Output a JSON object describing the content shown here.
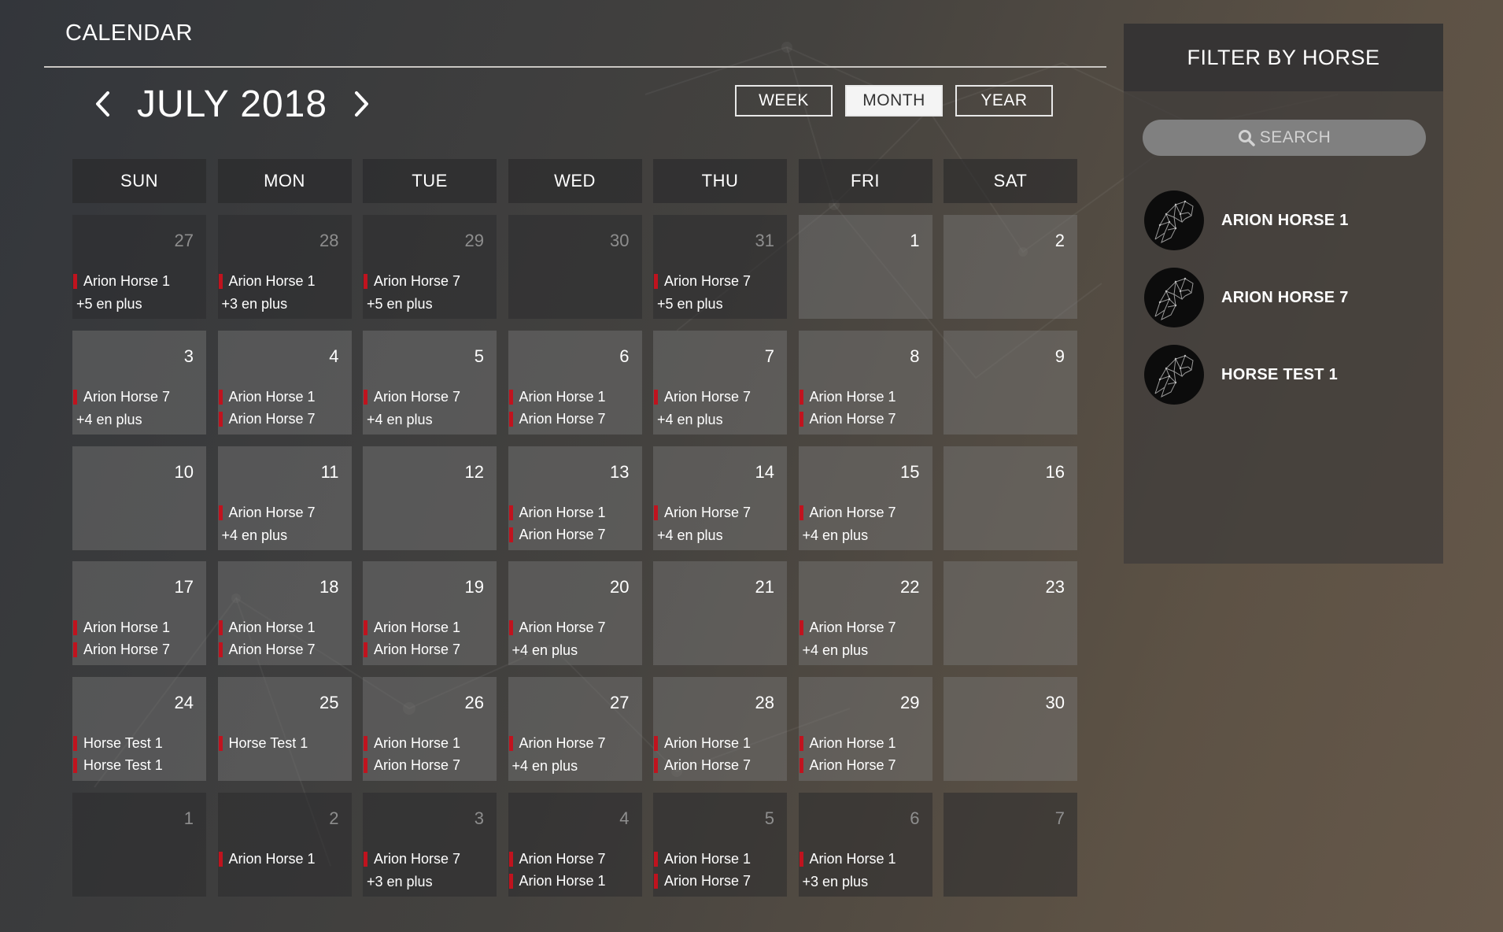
{
  "header": {
    "title": "CALENDAR",
    "month_label": "JULY 2018",
    "views": [
      {
        "label": "WEEK",
        "active": false
      },
      {
        "label": "MONTH",
        "active": true
      },
      {
        "label": "YEAR",
        "active": false
      }
    ]
  },
  "calendar": {
    "day_headers": [
      "SUN",
      "MON",
      "TUE",
      "WED",
      "THU",
      "FRI",
      "SAT"
    ],
    "weeks": [
      [
        {
          "num": "27",
          "other": true,
          "events": [
            "Arion Horse 1"
          ],
          "more": "+5 en plus"
        },
        {
          "num": "28",
          "other": true,
          "events": [
            "Arion Horse 1"
          ],
          "more": "+3 en plus"
        },
        {
          "num": "29",
          "other": true,
          "events": [
            "Arion Horse 7"
          ],
          "more": "+5 en plus"
        },
        {
          "num": "30",
          "other": true,
          "events": [],
          "more": ""
        },
        {
          "num": "31",
          "other": true,
          "events": [
            "Arion Horse 7"
          ],
          "more": "+5 en plus"
        },
        {
          "num": "1",
          "other": false,
          "events": [],
          "more": ""
        },
        {
          "num": "2",
          "other": false,
          "events": [],
          "more": ""
        }
      ],
      [
        {
          "num": "3",
          "other": false,
          "events": [
            "Arion Horse 7"
          ],
          "more": "+4 en plus"
        },
        {
          "num": "4",
          "other": false,
          "events": [
            "Arion Horse 1",
            "Arion Horse 7"
          ],
          "more": ""
        },
        {
          "num": "5",
          "other": false,
          "events": [
            "Arion Horse 7"
          ],
          "more": "+4 en plus"
        },
        {
          "num": "6",
          "other": false,
          "events": [
            "Arion Horse 1",
            "Arion Horse 7"
          ],
          "more": ""
        },
        {
          "num": "7",
          "other": false,
          "events": [
            "Arion Horse 7"
          ],
          "more": "+4 en plus"
        },
        {
          "num": "8",
          "other": false,
          "events": [
            "Arion Horse 1",
            "Arion Horse 7"
          ],
          "more": ""
        },
        {
          "num": "9",
          "other": false,
          "events": [],
          "more": ""
        }
      ],
      [
        {
          "num": "10",
          "other": false,
          "events": [],
          "more": ""
        },
        {
          "num": "11",
          "other": false,
          "events": [
            "Arion Horse 7"
          ],
          "more": "+4 en plus"
        },
        {
          "num": "12",
          "other": false,
          "events": [],
          "more": ""
        },
        {
          "num": "13",
          "other": false,
          "events": [
            "Arion Horse 1",
            "Arion Horse 7"
          ],
          "more": ""
        },
        {
          "num": "14",
          "other": false,
          "events": [
            "Arion Horse 7"
          ],
          "more": "+4 en plus"
        },
        {
          "num": "15",
          "other": false,
          "events": [
            "Arion Horse 7"
          ],
          "more": "+4 en plus"
        },
        {
          "num": "16",
          "other": false,
          "events": [],
          "more": ""
        }
      ],
      [
        {
          "num": "17",
          "other": false,
          "events": [
            "Arion Horse 1",
            "Arion Horse 7"
          ],
          "more": ""
        },
        {
          "num": "18",
          "other": false,
          "events": [
            "Arion Horse 1",
            "Arion Horse 7"
          ],
          "more": ""
        },
        {
          "num": "19",
          "other": false,
          "events": [
            "Arion Horse 1",
            "Arion Horse 7"
          ],
          "more": ""
        },
        {
          "num": "20",
          "other": false,
          "events": [
            "Arion Horse 7"
          ],
          "more": "+4 en plus"
        },
        {
          "num": "21",
          "other": false,
          "events": [],
          "more": ""
        },
        {
          "num": "22",
          "other": false,
          "events": [
            "Arion Horse 7"
          ],
          "more": "+4 en plus"
        },
        {
          "num": "23",
          "other": false,
          "events": [],
          "more": ""
        }
      ],
      [
        {
          "num": "24",
          "other": false,
          "events": [
            "Horse Test 1",
            "Horse Test 1"
          ],
          "more": ""
        },
        {
          "num": "25",
          "other": false,
          "events": [
            "Horse Test 1"
          ],
          "more": ""
        },
        {
          "num": "26",
          "other": false,
          "events": [
            "Arion Horse 1",
            "Arion Horse 7"
          ],
          "more": ""
        },
        {
          "num": "27",
          "other": false,
          "events": [
            "Arion Horse 7"
          ],
          "more": "+4 en plus"
        },
        {
          "num": "28",
          "other": false,
          "events": [
            "Arion Horse 1",
            "Arion Horse 7"
          ],
          "more": ""
        },
        {
          "num": "29",
          "other": false,
          "events": [
            "Arion Horse 1",
            "Arion Horse 7"
          ],
          "more": ""
        },
        {
          "num": "30",
          "other": false,
          "events": [],
          "more": ""
        }
      ],
      [
        {
          "num": "1",
          "other": true,
          "events": [],
          "more": ""
        },
        {
          "num": "2",
          "other": true,
          "events": [
            "Arion Horse 1"
          ],
          "more": ""
        },
        {
          "num": "3",
          "other": true,
          "events": [
            "Arion Horse 7"
          ],
          "more": "+3 en plus"
        },
        {
          "num": "4",
          "other": true,
          "events": [
            "Arion Horse 7",
            "Arion Horse 1"
          ],
          "more": ""
        },
        {
          "num": "5",
          "other": true,
          "events": [
            "Arion Horse 1",
            "Arion Horse 7"
          ],
          "more": ""
        },
        {
          "num": "6",
          "other": true,
          "events": [
            "Arion Horse 1"
          ],
          "more": "+3 en plus"
        },
        {
          "num": "7",
          "other": true,
          "events": [],
          "more": ""
        }
      ]
    ]
  },
  "sidebar": {
    "title": "FILTER BY HORSE",
    "search_placeholder": "SEARCH",
    "horses": [
      {
        "name": "ARION HORSE 1"
      },
      {
        "name": "ARION HORSE 7"
      },
      {
        "name": "HORSE TEST 1"
      }
    ]
  },
  "colors": {
    "event_marker": "#c0131e",
    "active_view_bg": "#f4f4f4"
  },
  "icons": {
    "prev": "chevron-left-icon",
    "next": "chevron-right-icon",
    "search": "search-icon",
    "avatar": "horse-head-icon"
  }
}
